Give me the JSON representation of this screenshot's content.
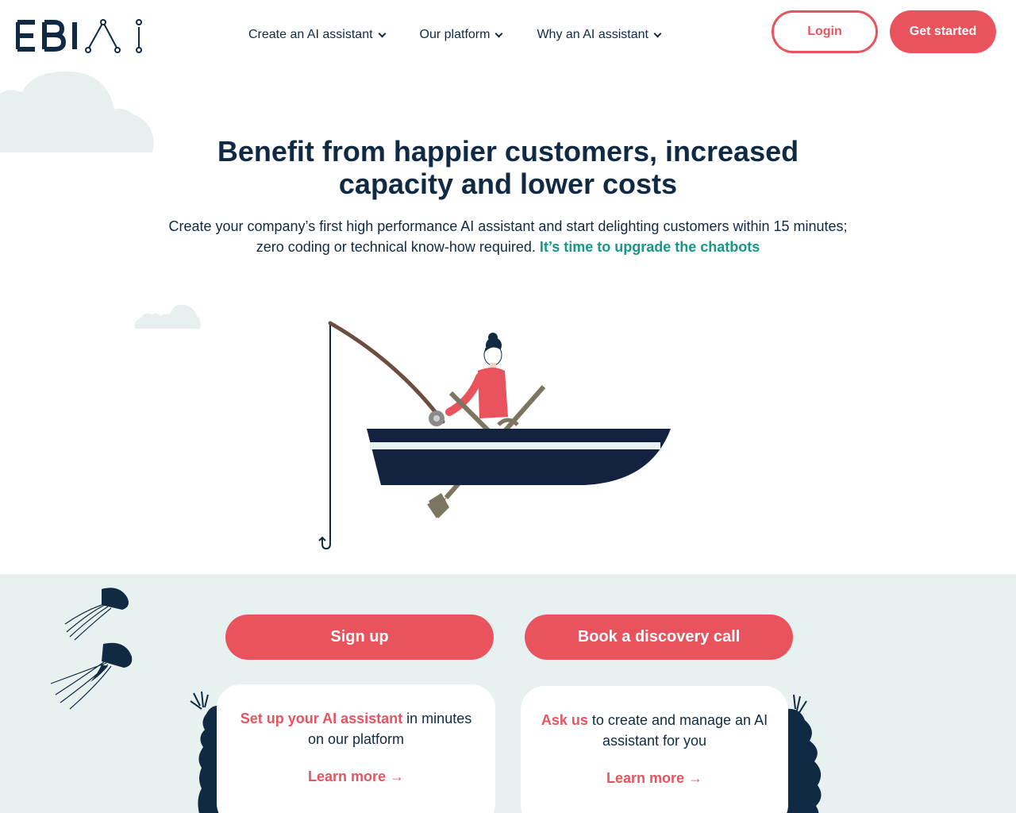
{
  "header": {
    "logo_text": "EBI AI",
    "nav": [
      {
        "label": "Create an AI assistant"
      },
      {
        "label": "Our platform"
      },
      {
        "label": "Why an AI assistant"
      }
    ],
    "login_label": "Login",
    "get_started_label": "Get started"
  },
  "hero": {
    "title_line1": "Benefit from happier customers, increased",
    "title_line2": "capacity and lower costs",
    "subtitle_line1": "Create your company’s first high performance AI assistant and start delighting customers within 15 minutes;",
    "subtitle_line2": "zero coding or technical know-how required.",
    "subtitle_link": "It’s time to upgrade the chatbots"
  },
  "cta": {
    "signup_label": "Sign up",
    "discovery_label": "Book a discovery call"
  },
  "cards": [
    {
      "highlight": "Set up your AI assistant",
      "text": " in minutes on our platform",
      "link": "Learn more →"
    },
    {
      "highlight": "Ask us",
      "text": " to create and manage an AI assistant for you",
      "link": "Learn more →"
    }
  ],
  "colors": {
    "brand_navy": "#102a44",
    "accent_red": "#e8535e",
    "accent_teal": "#139a86",
    "band_bg": "#e7f1f0"
  }
}
